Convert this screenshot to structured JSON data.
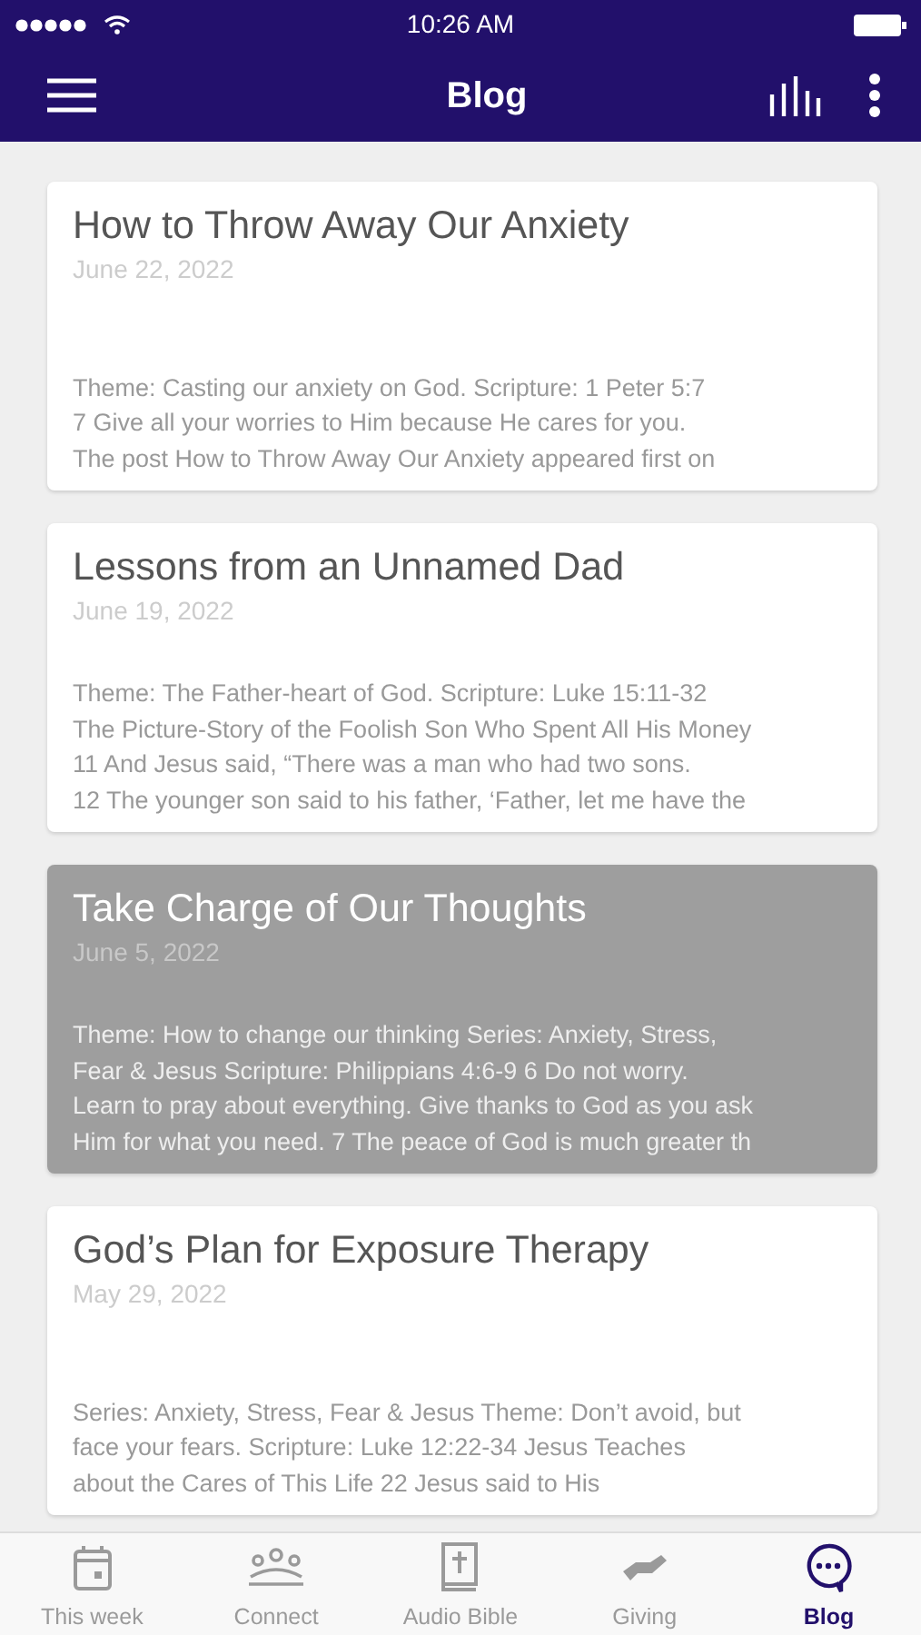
{
  "status_bar": {
    "time": "10:26 AM"
  },
  "header": {
    "title": "Blog"
  },
  "posts": [
    {
      "title": "How to Throw Away Our Anxiety",
      "date": "June 22, 2022",
      "selected": false,
      "excerpt": [
        "Theme:  Casting our anxiety on God. Scripture: 1 Peter 5:7",
        "7 Give all your worries to Him because He cares for you.",
        "The post How to Throw Away Our Anxiety appeared first on"
      ]
    },
    {
      "title": "Lessons from an Unnamed Dad",
      "date": "June 19, 2022",
      "selected": false,
      "excerpt": [
        "Theme:  The Father-heart of God. Scripture: Luke 15:11-32",
        "The Picture-Story of the Foolish Son Who Spent All His Money",
        "11 And Jesus said, “There was a man who had two sons.",
        "12 The younger son said to his father, ‘Father, let me have the"
      ]
    },
    {
      "title": "Take Charge of Our Thoughts",
      "date": "June 5, 2022",
      "selected": true,
      "excerpt": [
        "Theme:  How to change our thinking Series:  Anxiety, Stress,",
        "Fear & Jesus Scripture: Philippians 4:6-9  6 Do not worry.",
        "Learn to pray about everything. Give thanks to God as you ask",
        "Him for what you need. 7 The peace of God is much greater th"
      ]
    },
    {
      "title": "God’s Plan for Exposure Therapy",
      "date": "May 29, 2022",
      "selected": false,
      "excerpt": [
        "Series:  Anxiety, Stress, Fear & Jesus Theme:  Don’t avoid, but",
        "face your fears. Scripture: Luke 12:22-34  Jesus Teaches",
        "about the Cares of This Life 22 Jesus said to His"
      ]
    }
  ],
  "tabs": [
    {
      "kind": "calendar",
      "label": "This week",
      "selected": false
    },
    {
      "kind": "people",
      "label": "Connect",
      "selected": false
    },
    {
      "kind": "bible",
      "label": "Audio Bible",
      "selected": false
    },
    {
      "kind": "giving",
      "label": "Giving",
      "selected": false
    },
    {
      "kind": "chat",
      "label": "Blog",
      "selected": true
    }
  ]
}
